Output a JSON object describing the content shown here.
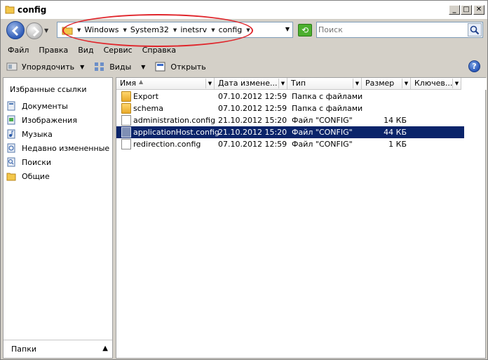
{
  "window": {
    "title": "config",
    "min_label": "_",
    "max_label": "□",
    "close_label": "✕"
  },
  "address": {
    "crumbs": [
      "Windows",
      "System32",
      "inetsrv",
      "config"
    ],
    "search_placeholder": "Поиск"
  },
  "menu": [
    "Файл",
    "Правка",
    "Вид",
    "Сервис",
    "Справка"
  ],
  "toolbar": {
    "organize": "Упорядочить",
    "views": "Виды",
    "open": "Открыть",
    "help": "?"
  },
  "nav": {
    "heading": "Избранные ссылки",
    "links": [
      "Документы",
      "Изображения",
      "Музыка",
      "Недавно измененные",
      "Поиски",
      "Общие"
    ],
    "folders": "Папки"
  },
  "columns": [
    "Имя",
    "Дата измене...",
    "Тип",
    "Размер",
    "Ключев..."
  ],
  "files": [
    {
      "name": "Export",
      "date": "07.10.2012 12:59",
      "type": "Папка с файлами",
      "size": "",
      "kind": "folder",
      "selected": false
    },
    {
      "name": "schema",
      "date": "07.10.2012 12:59",
      "type": "Папка с файлами",
      "size": "",
      "kind": "folder",
      "selected": false
    },
    {
      "name": "administration.config",
      "date": "21.10.2012 15:20",
      "type": "Файл \"CONFIG\"",
      "size": "14 КБ",
      "kind": "file",
      "selected": false
    },
    {
      "name": "applicationHost.config",
      "date": "21.10.2012 15:20",
      "type": "Файл \"CONFIG\"",
      "size": "44 КБ",
      "kind": "file",
      "selected": true
    },
    {
      "name": "redirection.config",
      "date": "07.10.2012 12:59",
      "type": "Файл \"CONFIG\"",
      "size": "1 КБ",
      "kind": "file",
      "selected": false
    }
  ],
  "colors": {
    "selection": "#0a246a",
    "annotation": "#e0252b"
  }
}
